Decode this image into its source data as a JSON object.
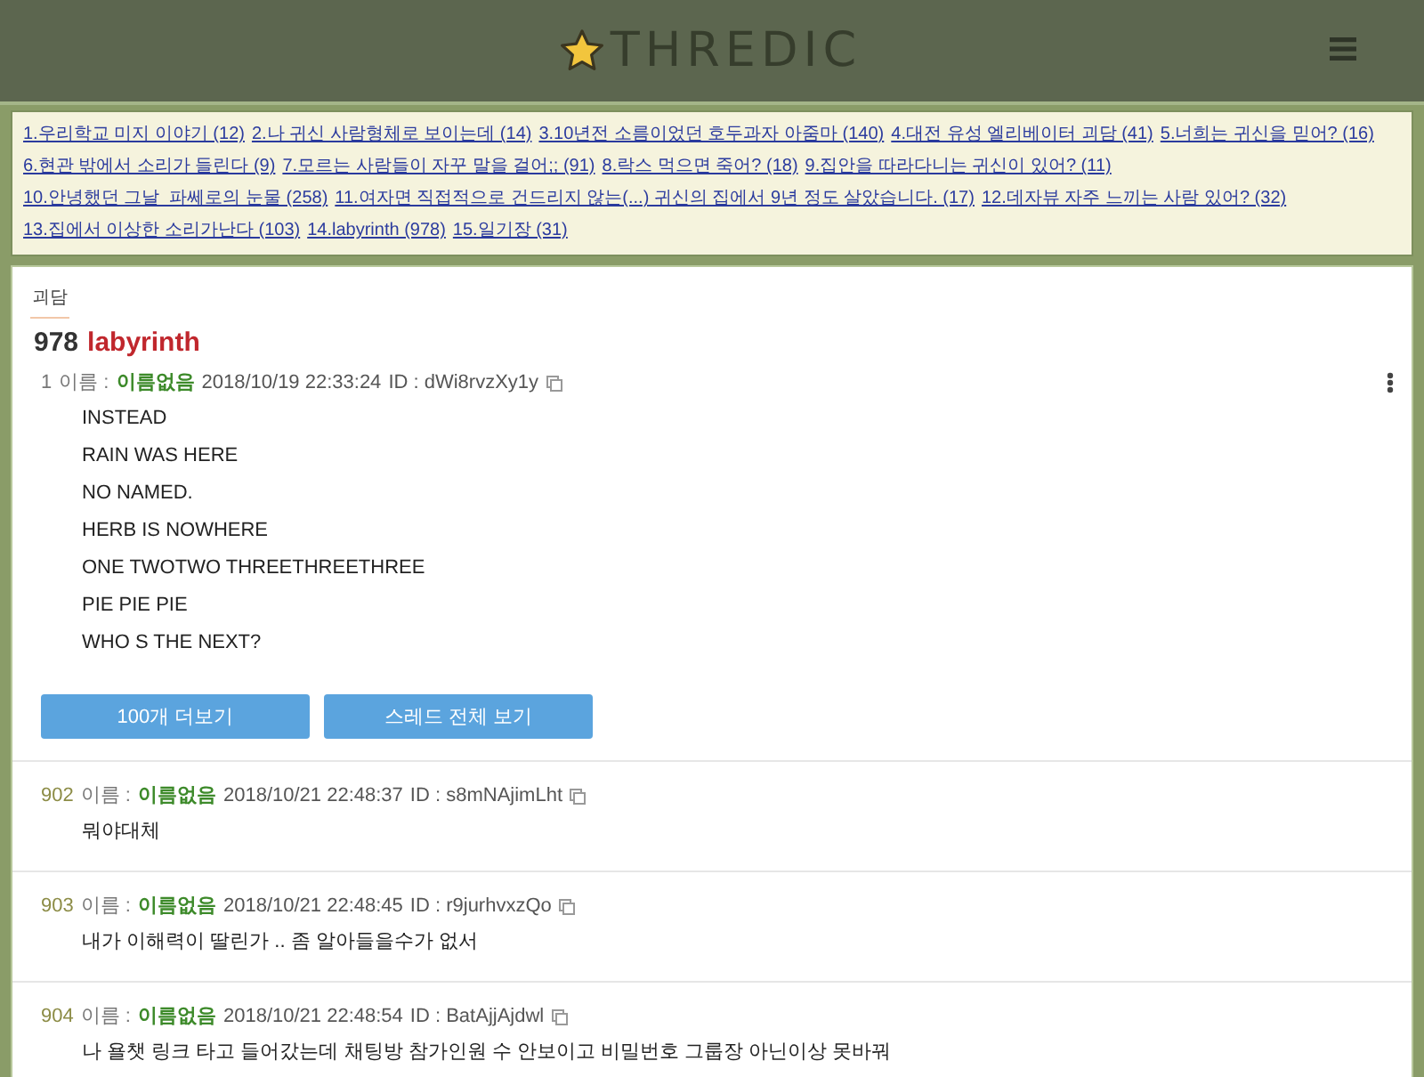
{
  "header": {
    "logo": "THREDIC"
  },
  "thread_list": [
    {
      "label": "1.우리학교 미지 이야기 (12)"
    },
    {
      "label": "2.나 귀신 사람형체로 보이는데 (14)"
    },
    {
      "label": "3.10년전 소름이었던 호두과자 아줌마 (140)"
    },
    {
      "label": "4.대전 유성 엘리베이터 괴담 (41)"
    },
    {
      "label": "5.너희는 귀신을 믿어? (16)"
    },
    {
      "label": "6.현관 밖에서 소리가 들린다 (9)"
    },
    {
      "label": "7.모르는 사람들이 자꾸 말을 걸어;; (91)"
    },
    {
      "label": "8.락스 먹으면 죽어? (18)"
    },
    {
      "label": "9.집안을 따라다니는 귀신이 있어? (11)"
    },
    {
      "label": "10.안녕했던 그날_파쎄로의 눈물 (258)"
    },
    {
      "label": "11.여자면 직접적으로 건드리지 않는(...) 귀신의 집에서 9년 정도 살았습니다. (17)"
    },
    {
      "label": "12.데자뷰 자주 느끼는 사람 있어? (32)"
    },
    {
      "label": "13.집에서 이상한 소리가난다 (103)"
    },
    {
      "label": "14.labyrinth (978)"
    },
    {
      "label": "15.일기장 (31)"
    }
  ],
  "board": {
    "category": "괴담",
    "thread_number": "978",
    "thread_title": "labyrinth"
  },
  "first_post": {
    "number": "1",
    "name_label": "이름 :",
    "name": "이름없음",
    "date": "2018/10/19 22:33:24",
    "id": "ID : dWi8rvzXy1y",
    "lines": [
      "INSTEAD",
      "RAIN WAS HERE",
      "NO NAMED.",
      "HERB IS NOWHERE",
      "ONE TWOTWO THREETHREETHREE",
      "PIE PIE PIE",
      "WHO S THE NEXT?"
    ]
  },
  "buttons": [
    "100개 더보기",
    "스레드 전체 보기"
  ],
  "replies": [
    {
      "number": "902",
      "name_label": "이름 :",
      "name": "이름없음",
      "date": "2018/10/21 22:48:37",
      "id": "ID : s8mNAjimLht",
      "text": "뭐야대체"
    },
    {
      "number": "903",
      "name_label": "이름 :",
      "name": "이름없음",
      "date": "2018/10/21 22:48:45",
      "id": "ID : r9jurhvxzQo",
      "text": "내가 이해력이 딸린가 .. 좀 알아들을수가 없서"
    },
    {
      "number": "904",
      "name_label": "이름 :",
      "name": "이름없음",
      "date": "2018/10/21 22:48:54",
      "id": "ID : BatAjjAjdwl",
      "text": "나 욜챗 링크 타고 들어갔는데 채팅방 참가인원 수 안보이고 비밀번호 그룹장 아닌이상 못바꿔"
    }
  ]
}
